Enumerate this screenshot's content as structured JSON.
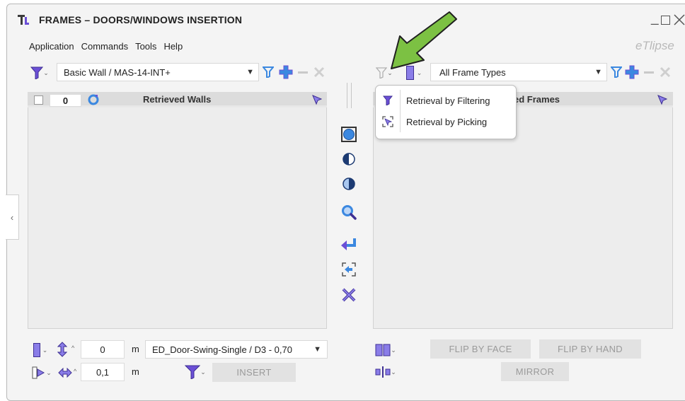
{
  "window": {
    "title": "FRAMES – DOORS/WINDOWS INSERTION",
    "brand": "eTlipse",
    "controls": [
      "minimize-icon",
      "maximize-icon",
      "close-icon"
    ]
  },
  "menu": [
    "Application",
    "Commands",
    "Tools",
    "Help"
  ],
  "left": {
    "wall_type": "Basic Wall / MAS-14-INT+",
    "count": "0",
    "header": "Retrieved Walls",
    "height_value": "0",
    "height_unit": "m",
    "family_type": "ED_Door-Swing-Single / D3 - 0,70",
    "offset_value": "0,1",
    "offset_unit": "m",
    "insert_label": "INSERT"
  },
  "right": {
    "frame_types": "All Frame Types",
    "header_partial": "ed Frames",
    "flip_face": "FLIP BY FACE",
    "flip_hand": "FLIP BY HAND",
    "mirror": "MIRROR"
  },
  "dropdown": {
    "items": [
      "Retrieval by Filtering",
      "Retrieval by Picking"
    ]
  },
  "colors": {
    "accent_purple": "#6b4fd6",
    "accent_blue": "#3b88e0",
    "arrow_green": "#7cc143"
  }
}
